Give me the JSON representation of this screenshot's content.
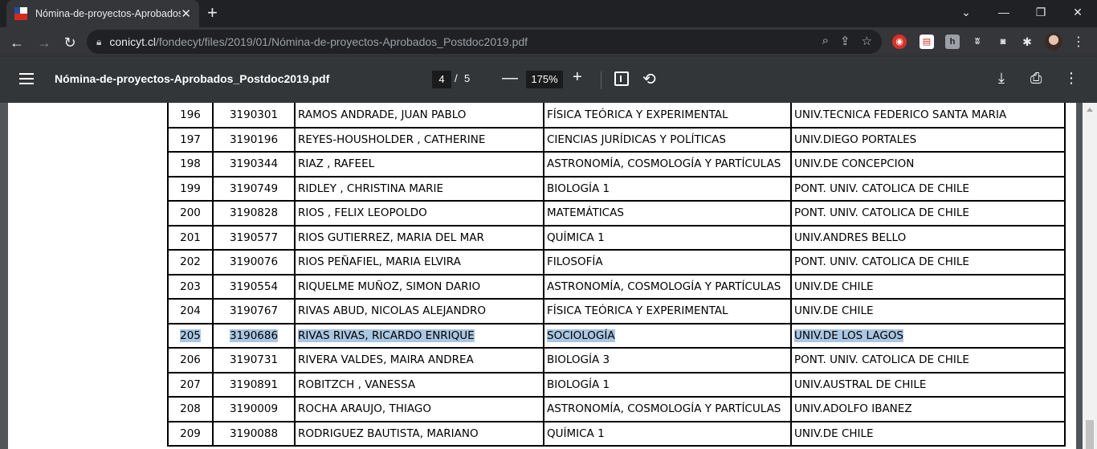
{
  "browser": {
    "tab_title": "Nómina-de-proyectos-Aprobados_Postdoc2019.pdf",
    "close_label": "✕",
    "new_tab_label": "+",
    "url_host": "conicyt.cl",
    "url_path": "/fondecyt/files/2019/01/Nómina-de-proyectos-Aprobados_Postdoc2019.pdf"
  },
  "pdf_toolbar": {
    "title": "Nómina-de-proyectos-Aprobados_Postdoc2019.pdf",
    "current_page": "4",
    "page_separator": "/",
    "total_pages": "5",
    "zoom": "175%"
  },
  "table": {
    "rows": [
      {
        "n": "196",
        "code": "3190301",
        "name": "RAMOS ANDRADE, JUAN PABLO",
        "area": "FÍSICA TEÓRICA Y EXPERIMENTAL",
        "inst": "UNIV.TECNICA FEDERICO SANTA MARIA"
      },
      {
        "n": "197",
        "code": "3190196",
        "name": "REYES-HOUSHOLDER , CATHERINE",
        "area": "CIENCIAS JURÍDICAS Y POLÍTICAS",
        "inst": "UNIV.DIEGO PORTALES"
      },
      {
        "n": "198",
        "code": "3190344",
        "name": "RIAZ , RAFEEL",
        "area": "ASTRONOMÍA, COSMOLOGÍA Y PARTÍCULAS",
        "inst": "UNIV.DE CONCEPCION"
      },
      {
        "n": "199",
        "code": "3190749",
        "name": "RIDLEY , CHRISTINA MARIE",
        "area": "BIOLOGÍA 1",
        "inst": "PONT. UNIV. CATOLICA DE CHILE"
      },
      {
        "n": "200",
        "code": "3190828",
        "name": "RIOS , FELIX LEOPOLDO",
        "area": "MATEMÁTICAS",
        "inst": "PONT. UNIV. CATOLICA DE CHILE"
      },
      {
        "n": "201",
        "code": "3190577",
        "name": "RIOS GUTIERREZ, MARIA DEL MAR",
        "area": "QUÍMICA 1",
        "inst": "UNIV.ANDRES BELLO"
      },
      {
        "n": "202",
        "code": "3190076",
        "name": "RIOS PEÑAFIEL, MARIA ELVIRA",
        "area": "FILOSOFÍA",
        "inst": "PONT. UNIV. CATOLICA DE CHILE"
      },
      {
        "n": "203",
        "code": "3190554",
        "name": "RIQUELME MUÑOZ, SIMON DARIO",
        "area": "ASTRONOMÍA, COSMOLOGÍA Y PARTÍCULAS",
        "inst": "UNIV.DE CHILE"
      },
      {
        "n": "204",
        "code": "3190767",
        "name": "RIVAS ABUD, NICOLAS ALEJANDRO",
        "area": "FÍSICA TEÓRICA Y EXPERIMENTAL",
        "inst": "UNIV.DE CHILE"
      },
      {
        "n": "205",
        "code": "3190686",
        "name": "RIVAS RIVAS, RICARDO ENRIQUE",
        "area": "SOCIOLOGÍA",
        "inst": "UNIV.DE LOS LAGOS",
        "selected": true
      },
      {
        "n": "206",
        "code": "3190731",
        "name": "RIVERA VALDES, MAIRA ANDREA",
        "area": "BIOLOGÍA 3",
        "inst": "PONT. UNIV. CATOLICA DE CHILE"
      },
      {
        "n": "207",
        "code": "3190891",
        "name": "ROBITZCH , VANESSA",
        "area": "BIOLOGÍA 1",
        "inst": "UNIV.AUSTRAL DE CHILE"
      },
      {
        "n": "208",
        "code": "3190009",
        "name": "ROCHA ARAUJO, THIAGO",
        "area": "ASTRONOMÍA, COSMOLOGÍA Y PARTÍCULAS",
        "inst": "UNIV.ADOLFO IBANEZ"
      },
      {
        "n": "209",
        "code": "3190088",
        "name": "RODRIGUEZ BAUTISTA, MARIANO",
        "area": "QUÍMICA 1",
        "inst": "UNIV.DE CHILE"
      }
    ]
  },
  "colors": {
    "selection": "#a9c6e3",
    "pdf_toolbar_bg": "#323639",
    "viewer_bg": "#525659"
  }
}
